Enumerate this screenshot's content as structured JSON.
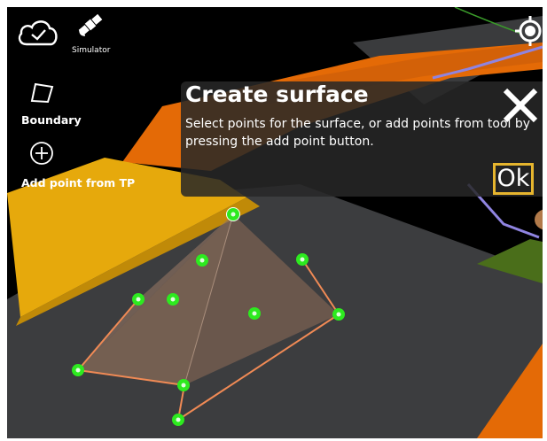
{
  "toolbar": {
    "cloud_icon": "cloud-check-icon",
    "simulator_icon": "satellite-icon",
    "simulator_label": "Simulator",
    "locate_icon": "crosshair-icon"
  },
  "tools": {
    "boundary_icon": "polygon-icon",
    "boundary_label": "Boundary",
    "add_point_icon": "add-circle-icon",
    "add_point_label": "Add point from TP"
  },
  "dialog": {
    "title": "Create surface",
    "message": "Select points for the surface, or add points from tool by pressing the add point button.",
    "close_icon": "close-icon",
    "ok_label": "Ok"
  },
  "colors": {
    "point": "#2dea1f",
    "edge": "#f08a55",
    "surface_yellow": "#e6a90c",
    "surface_orange": "#e46a06",
    "accent_border": "#e6b52e"
  }
}
